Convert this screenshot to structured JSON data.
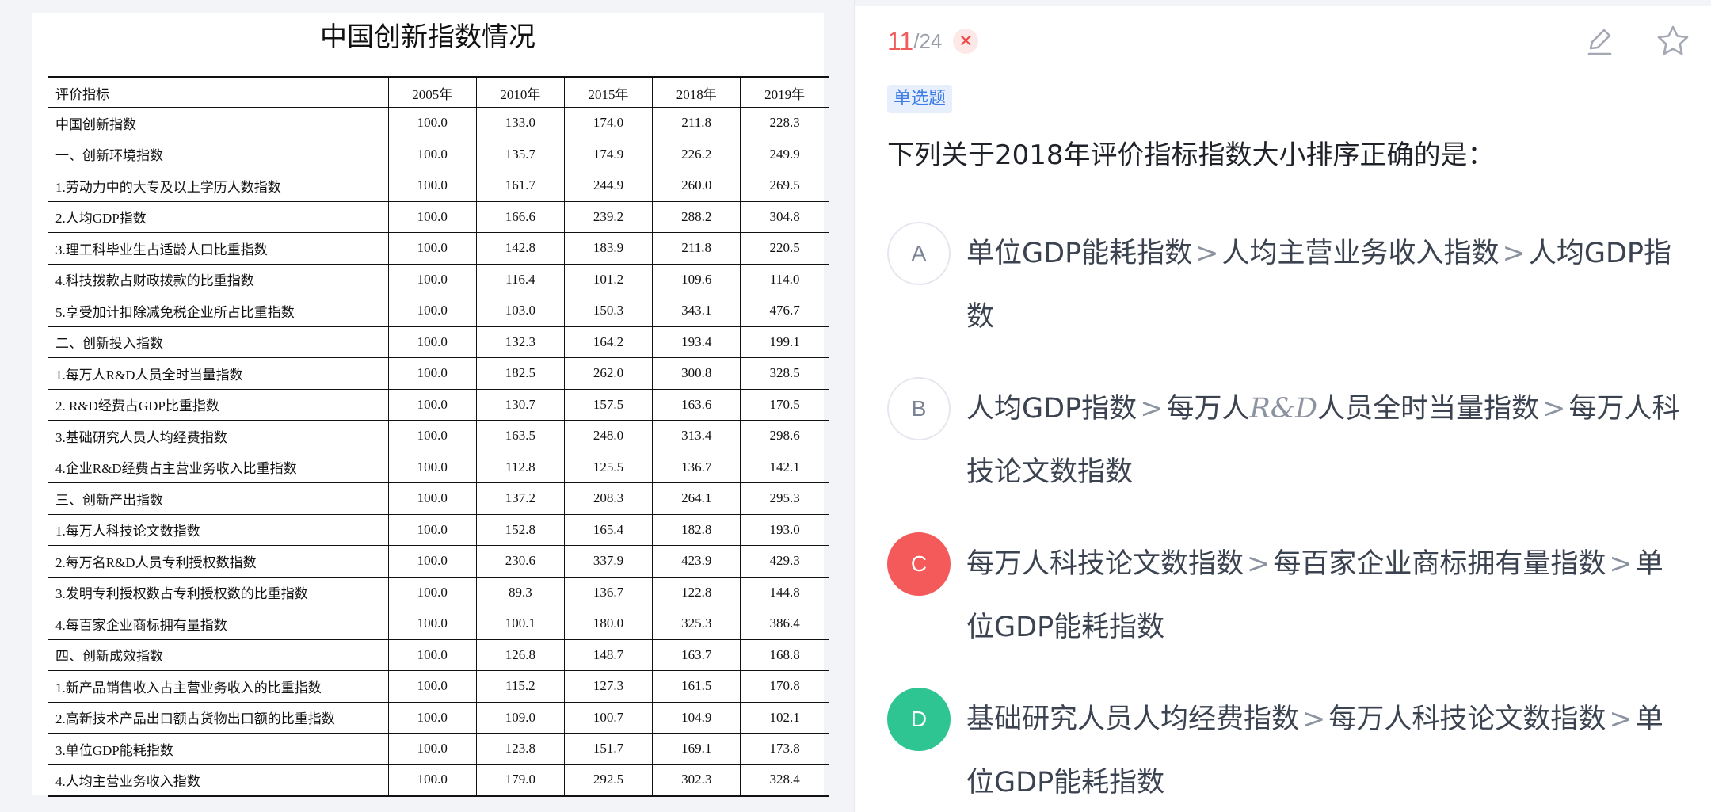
{
  "document": {
    "title": "中国创新指数情况",
    "columns": [
      "评价指标",
      "2005年",
      "2010年",
      "2015年",
      "2018年",
      "2019年"
    ],
    "rows": [
      [
        "中国创新指数",
        "100.0",
        "133.0",
        "174.0",
        "211.8",
        "228.3"
      ],
      [
        "一、创新环境指数",
        "100.0",
        "135.7",
        "174.9",
        "226.2",
        "249.9"
      ],
      [
        "1.劳动力中的大专及以上学历人数指数",
        "100.0",
        "161.7",
        "244.9",
        "260.0",
        "269.5"
      ],
      [
        "2.人均GDP指数",
        "100.0",
        "166.6",
        "239.2",
        "288.2",
        "304.8"
      ],
      [
        "3.理工科毕业生占适龄人口比重指数",
        "100.0",
        "142.8",
        "183.9",
        "211.8",
        "220.5"
      ],
      [
        "4.科技拨款占财政拨款的比重指数",
        "100.0",
        "116.4",
        "101.2",
        "109.6",
        "114.0"
      ],
      [
        "5.享受加计扣除减免税企业所占比重指数",
        "100.0",
        "103.0",
        "150.3",
        "343.1",
        "476.7"
      ],
      [
        "二、创新投入指数",
        "100.0",
        "132.3",
        "164.2",
        "193.4",
        "199.1"
      ],
      [
        "1.每万人R&D人员全时当量指数",
        "100.0",
        "182.5",
        "262.0",
        "300.8",
        "328.5"
      ],
      [
        "2. R&D经费占GDP比重指数",
        "100.0",
        "130.7",
        "157.5",
        "163.6",
        "170.5"
      ],
      [
        "3.基础研究人员人均经费指数",
        "100.0",
        "163.5",
        "248.0",
        "313.4",
        "298.6"
      ],
      [
        "4.企业R&D经费占主营业务收入比重指数",
        "100.0",
        "112.8",
        "125.5",
        "136.7",
        "142.1"
      ],
      [
        "三、创新产出指数",
        "100.0",
        "137.2",
        "208.3",
        "264.1",
        "295.3"
      ],
      [
        "1.每万人科技论文数指数",
        "100.0",
        "152.8",
        "165.4",
        "182.8",
        "193.0"
      ],
      [
        "2.每万名R&D人员专利授权数指数",
        "100.0",
        "230.6",
        "337.9",
        "423.9",
        "429.3"
      ],
      [
        "3.发明专利授权数占专利授权数的比重指数",
        "100.0",
        "89.3",
        "136.7",
        "122.8",
        "144.8"
      ],
      [
        "4.每百家企业商标拥有量指数",
        "100.0",
        "100.1",
        "180.0",
        "325.3",
        "386.4"
      ],
      [
        "四、创新成效指数",
        "100.0",
        "126.8",
        "148.7",
        "163.7",
        "168.8"
      ],
      [
        "1.新产品销售收入占主营业务收入的比重指数",
        "100.0",
        "115.2",
        "127.3",
        "161.5",
        "170.8"
      ],
      [
        "2.高新技术产品出口额占货物出口额的比重指数",
        "100.0",
        "109.0",
        "100.7",
        "104.9",
        "102.1"
      ],
      [
        "3.单位GDP能耗指数",
        "100.0",
        "123.8",
        "151.7",
        "169.1",
        "173.8"
      ],
      [
        "4.人均主营业务收入指数",
        "100.0",
        "179.0",
        "292.5",
        "302.3",
        "328.4"
      ]
    ]
  },
  "quiz": {
    "progress": {
      "current": "11",
      "separator": "/",
      "total": "24"
    },
    "status_icon": "wrong-x-icon",
    "toolbar": {
      "edit_icon": "pencil-icon",
      "favorite_icon": "star-icon"
    },
    "type_label": "单选题",
    "question": "下列关于2018年评价指标指数大小排序正确的是：",
    "options": [
      {
        "letter": "A",
        "state": "default",
        "parts": [
          "单位GDP能耗指数",
          ">",
          "人均主营业务收入指数",
          ">",
          "人均GDP指数"
        ]
      },
      {
        "letter": "B",
        "state": "default",
        "parts": [
          "人均GDP指数",
          ">",
          "每万人",
          "R&D",
          "人员全时当量指数",
          ">",
          "每万人科技论文数指数"
        ]
      },
      {
        "letter": "C",
        "state": "wrong",
        "parts": [
          "每万人科技论文数指数",
          ">",
          "每百家企业商标拥有量指数",
          ">",
          "单位GDP能耗指数"
        ]
      },
      {
        "letter": "D",
        "state": "correct",
        "parts": [
          "基础研究人员人均经费指数",
          ">",
          "每万人科技论文数指数",
          ">",
          "单位GDP能耗指数"
        ]
      }
    ]
  },
  "colors": {
    "wrong": "#f55a5a",
    "correct": "#2ec592",
    "badge_text": "#3e7de6",
    "badge_bg": "#e8effc",
    "counter_current": "#f25b5b"
  }
}
